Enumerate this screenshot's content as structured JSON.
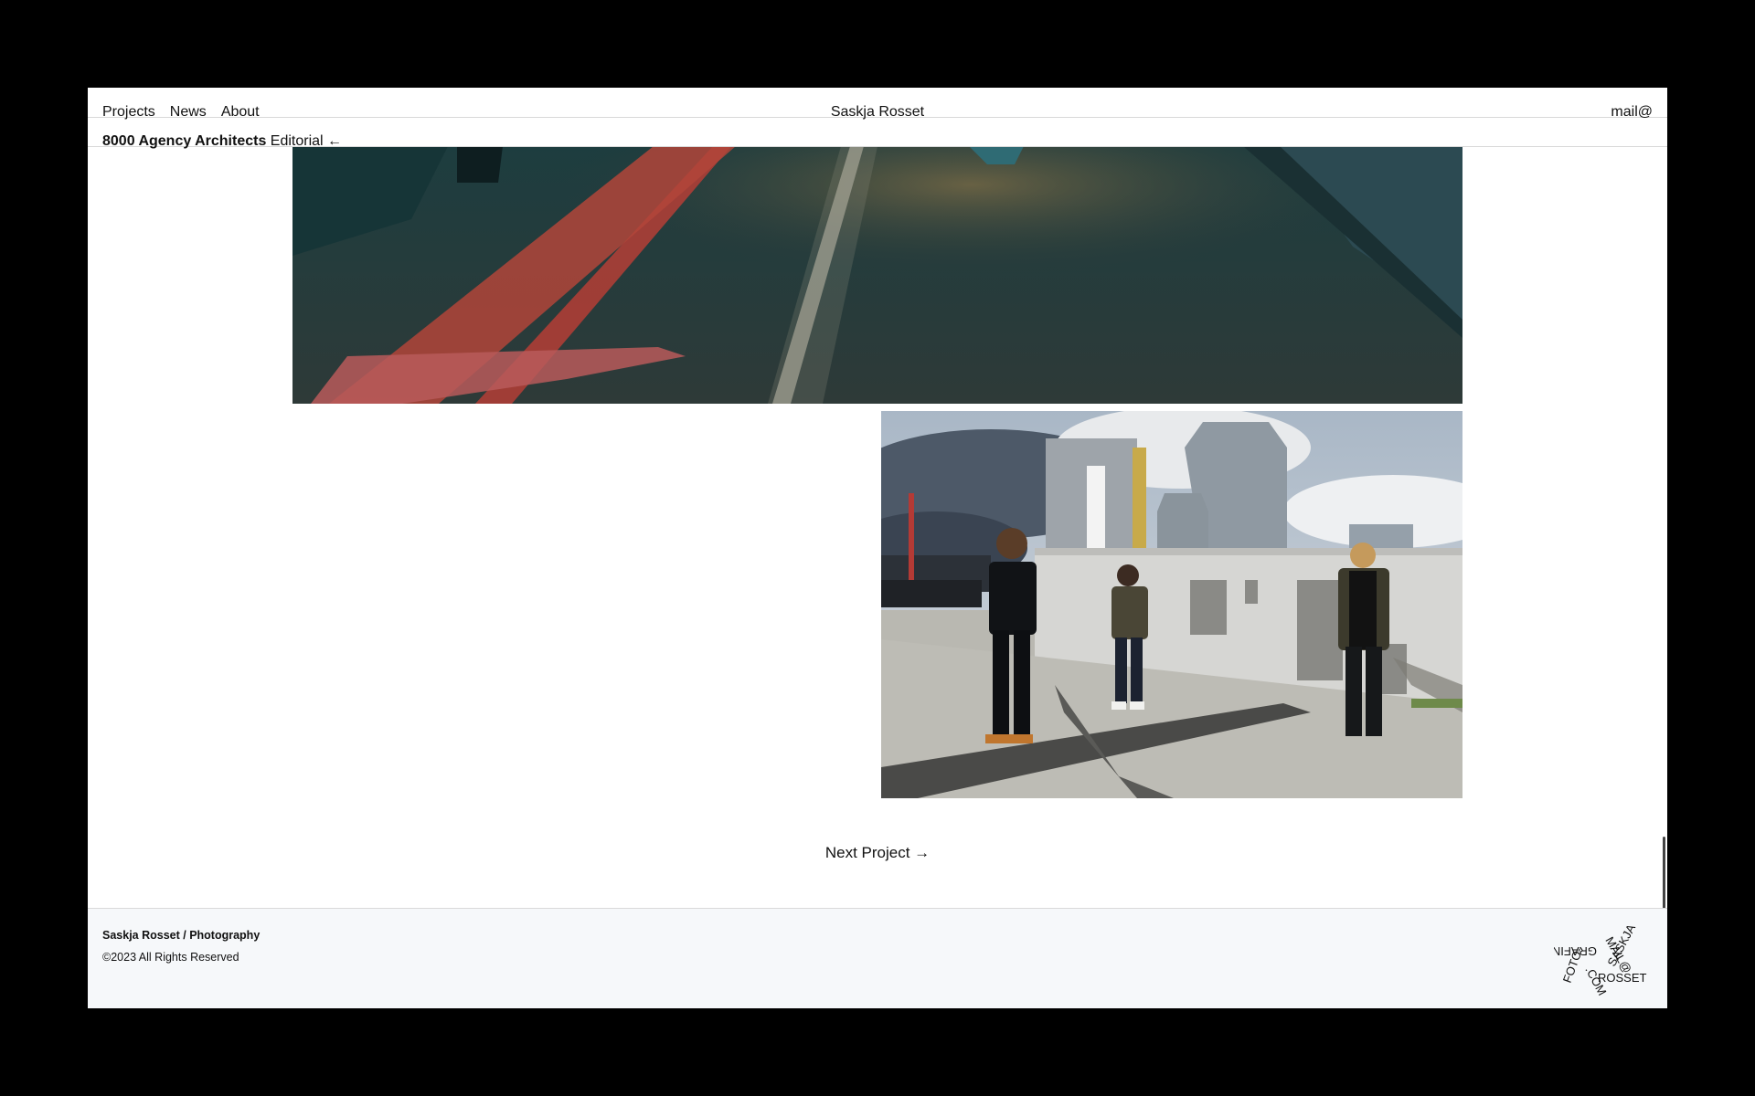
{
  "nav": {
    "projects": "Projects",
    "news": "News",
    "about": "About"
  },
  "brand": "Saskja Rosset",
  "mail": "mail@",
  "project": {
    "title": "8000 Agency Architects",
    "category": "Editorial ←"
  },
  "next_project": "Next Project →",
  "footer": {
    "name": "Saskja Rosset / Photography",
    "copyright": "©2023 All Rights Reserved"
  },
  "logo": {
    "word1": "SASKJA",
    "word2": "ROSSET",
    "word3": "FOTO-",
    "word4": "GRAFIN",
    "word5": "MAIL@",
    "word6": ".COM"
  }
}
